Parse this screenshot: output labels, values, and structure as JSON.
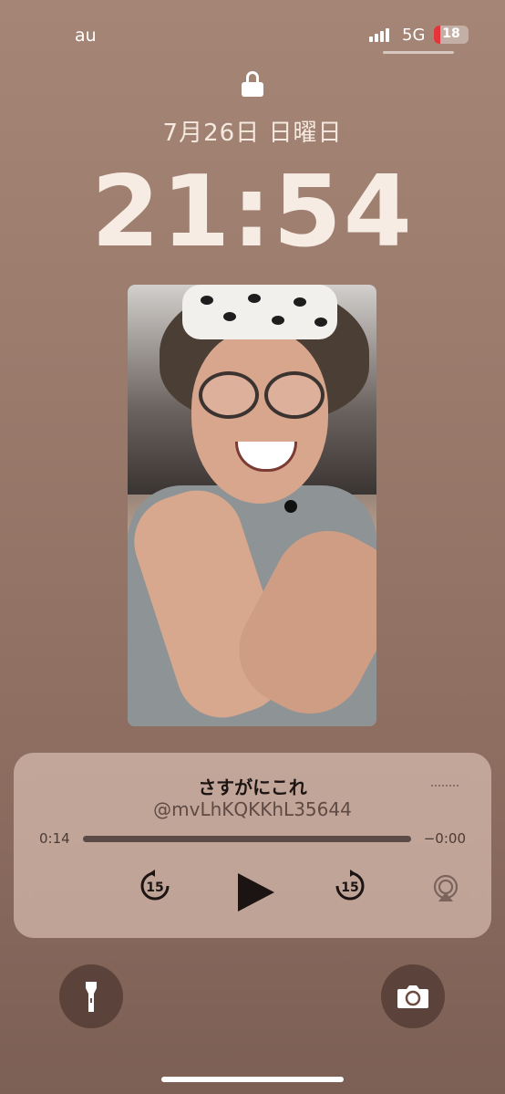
{
  "status_bar": {
    "carrier": "au",
    "network": "5G",
    "battery": "18",
    "battery_color": "#e6343a"
  },
  "lock_screen": {
    "lock_icon": "lock-icon",
    "date": "7月26日 日曜日",
    "time": "21:54"
  },
  "wallpaper": {
    "icon": "photo"
  },
  "now_playing": {
    "title": "さすがにこれ",
    "subtitle": "@mvLhKQKKhL35644",
    "elapsed": "0:14",
    "remaining": "−0:00",
    "skip_back_label": "15",
    "skip_forward_label": "15",
    "play_icon": "play-icon",
    "airplay_icon": "airplay-icon",
    "more_icon": "more-icon"
  },
  "quick_actions": {
    "flashlight_icon": "flashlight-icon",
    "camera_icon": "camera-icon"
  }
}
